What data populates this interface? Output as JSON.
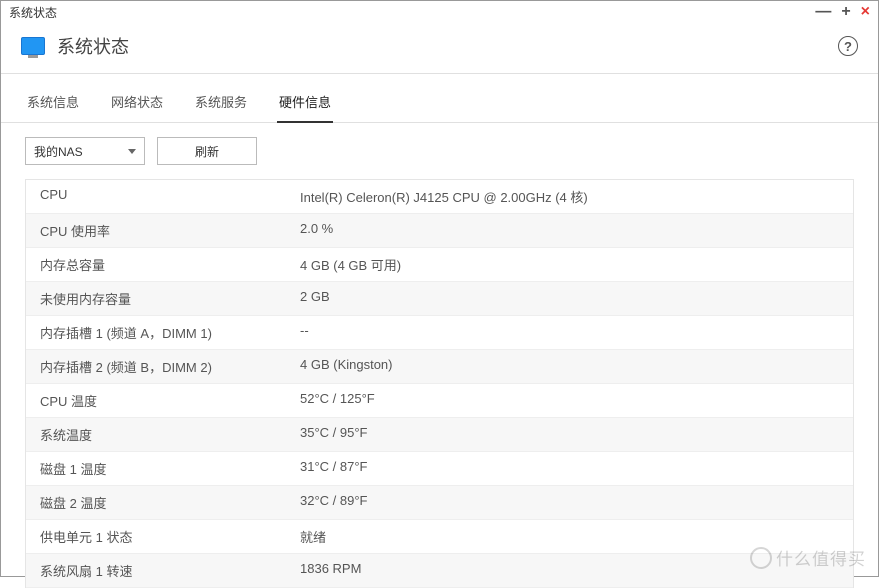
{
  "window": {
    "title": "系统状态"
  },
  "header": {
    "title": "系统状态"
  },
  "tabs": [
    {
      "label": "系统信息"
    },
    {
      "label": "网络状态"
    },
    {
      "label": "系统服务"
    },
    {
      "label": "硬件信息"
    }
  ],
  "toolbar": {
    "device_selector": "我的NAS",
    "refresh_label": "刷新"
  },
  "rows": [
    {
      "label": "CPU",
      "value": "Intel(R) Celeron(R) J4125 CPU @ 2.00GHz (4 核)"
    },
    {
      "label": "CPU 使用率",
      "value": "2.0 %"
    },
    {
      "label": "内存总容量",
      "value": "4 GB (4 GB 可用)"
    },
    {
      "label": "未使用内存容量",
      "value": "2 GB"
    },
    {
      "label": "内存插槽 1 (频道 A，DIMM 1)",
      "value": "--"
    },
    {
      "label": "内存插槽 2 (频道 B，DIMM 2)",
      "value": "4 GB (Kingston)"
    },
    {
      "label": "CPU 温度",
      "value": "52°C / 125°F"
    },
    {
      "label": "系统温度",
      "value": "35°C / 95°F"
    },
    {
      "label": "磁盘 1 温度",
      "value": "31°C / 87°F"
    },
    {
      "label": "磁盘 2 温度",
      "value": "32°C / 89°F"
    },
    {
      "label": "供电单元 1 状态",
      "value": "就绪"
    },
    {
      "label": "系统风扇 1 转速",
      "value": "1836 RPM"
    }
  ],
  "watermark": "什么值得买"
}
